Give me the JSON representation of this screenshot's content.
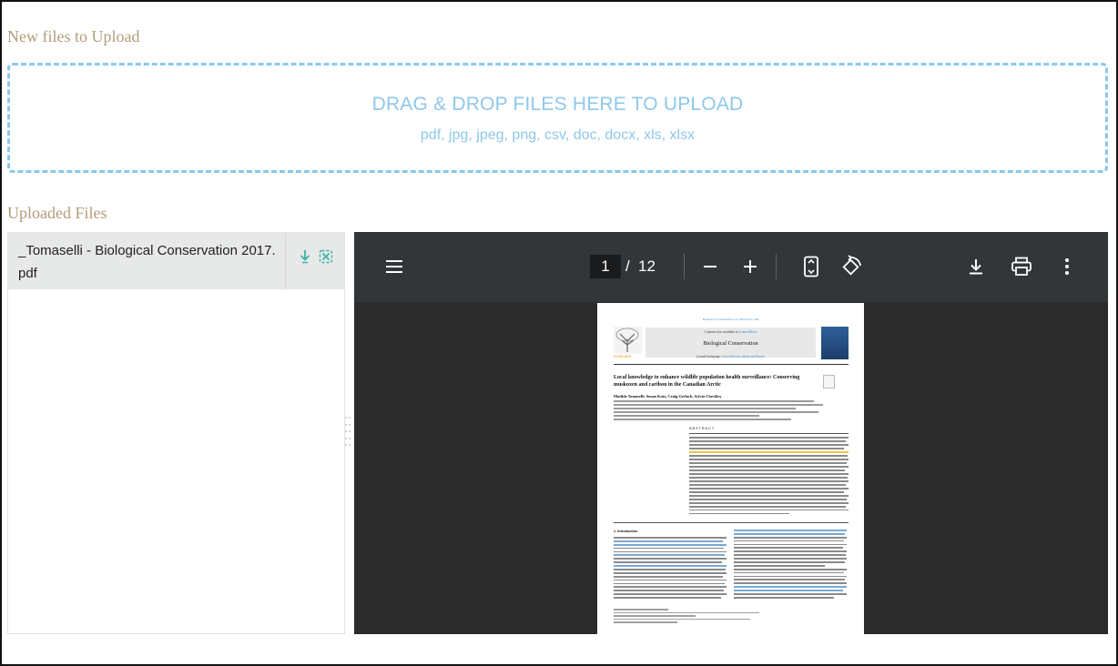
{
  "sections": {
    "new_files_title": "New files to Upload",
    "uploaded_files_title": "Uploaded Files"
  },
  "dropzone": {
    "main_text": "DRAG & DROP FILES HERE TO UPLOAD",
    "formats_text": "pdf, jpg, jpeg, png, csv, doc, docx, xls, xlsx",
    "color": "#8ec7ea"
  },
  "files": [
    {
      "name": "_Tomaselli - Biological Conservation 2017.pdf",
      "actions": [
        "download-icon",
        "remove-icon"
      ],
      "action_color": "#3bb3a4"
    }
  ],
  "pdf_viewer": {
    "current_page": "1",
    "separator": "/",
    "total_pages": "12",
    "toolbar_icons": [
      "menu-icon",
      "zoom-out-icon",
      "zoom-in-icon",
      "fit-page-icon",
      "rotate-icon",
      "download-icon",
      "print-icon",
      "more-icon"
    ],
    "page_preview": {
      "journal_ref": "Biological Conservation 217 (2018) 337–348",
      "contents_prefix": "Contents lists available at",
      "contents_link": "ScienceDirect",
      "journal_name": "Biological Conservation",
      "homepage_prefix": "journal homepage:",
      "homepage_link": "www.elsevier.com/locate/biocon",
      "publisher": "ELSEVIER",
      "title": "Local knowledge to enhance wildlife population health surveillance: Conserving muskoxen and caribou in the Canadian Arctic",
      "authors": "Matilde Tomaselli, Susan Kutz, Craig Gerlach, Sylvia Checkley",
      "abstract_heading": "ABSTRACT",
      "section_heading": "1. Introduction"
    }
  }
}
